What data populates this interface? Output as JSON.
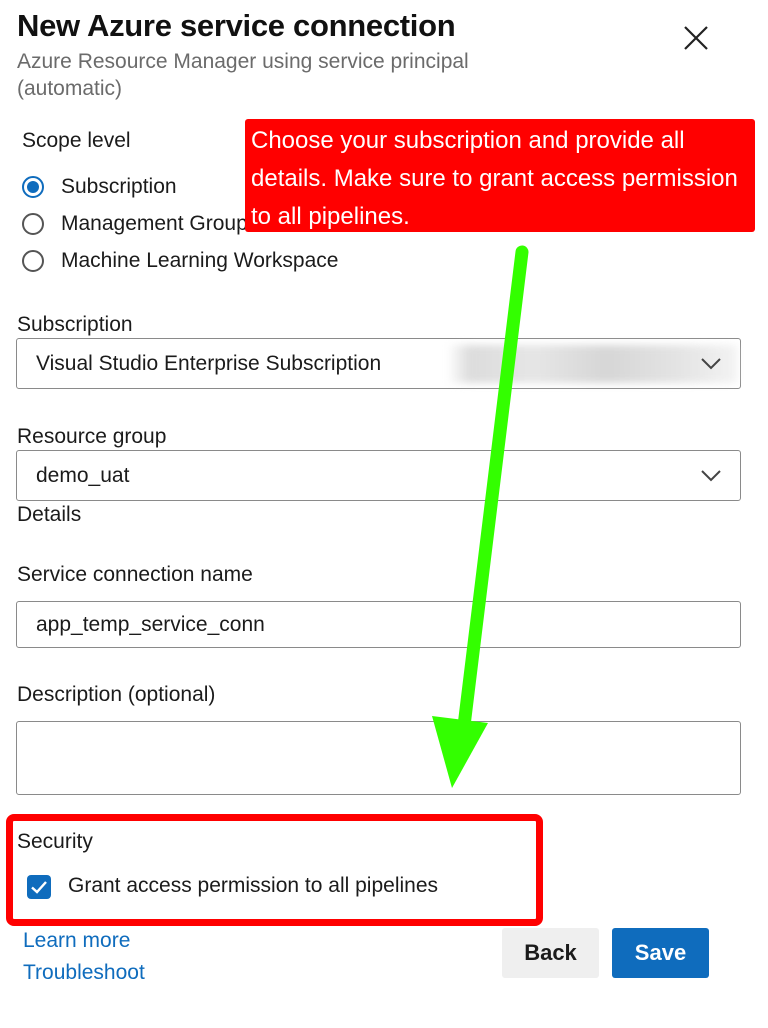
{
  "header": {
    "title": "New Azure service connection",
    "subtitle": "Azure Resource Manager using service principal (automatic)"
  },
  "icons": {
    "close": "close-icon",
    "chevron": "chevron-down-icon",
    "check": "check-icon"
  },
  "scope": {
    "label": "Scope level",
    "options": [
      {
        "label": "Subscription",
        "selected": true
      },
      {
        "label": "Management Group",
        "selected": false
      },
      {
        "label": "Machine Learning Workspace",
        "selected": false
      }
    ]
  },
  "subscription": {
    "label": "Subscription",
    "value": "Visual Studio Enterprise Subscription"
  },
  "resource_group": {
    "label": "Resource group",
    "value": "demo_uat"
  },
  "details": {
    "label": "Details"
  },
  "service_connection_name": {
    "label": "Service connection name",
    "value": "app_temp_service_conn"
  },
  "description": {
    "label": "Description (optional)",
    "value": ""
  },
  "security": {
    "label": "Security",
    "grant_access_label": "Grant access permission to all pipelines",
    "grant_access_checked": true
  },
  "links": {
    "learn_more": "Learn more",
    "troubleshoot": "Troubleshoot"
  },
  "buttons": {
    "back": "Back",
    "save": "Save"
  },
  "annotation": {
    "callout_text": "Choose your subscription and provide all details. Make sure to grant access permission to all pipelines."
  },
  "colors": {
    "accent": "#0f6cbd",
    "annotation_red": "#ff0000",
    "annotation_green": "#33ff00"
  }
}
